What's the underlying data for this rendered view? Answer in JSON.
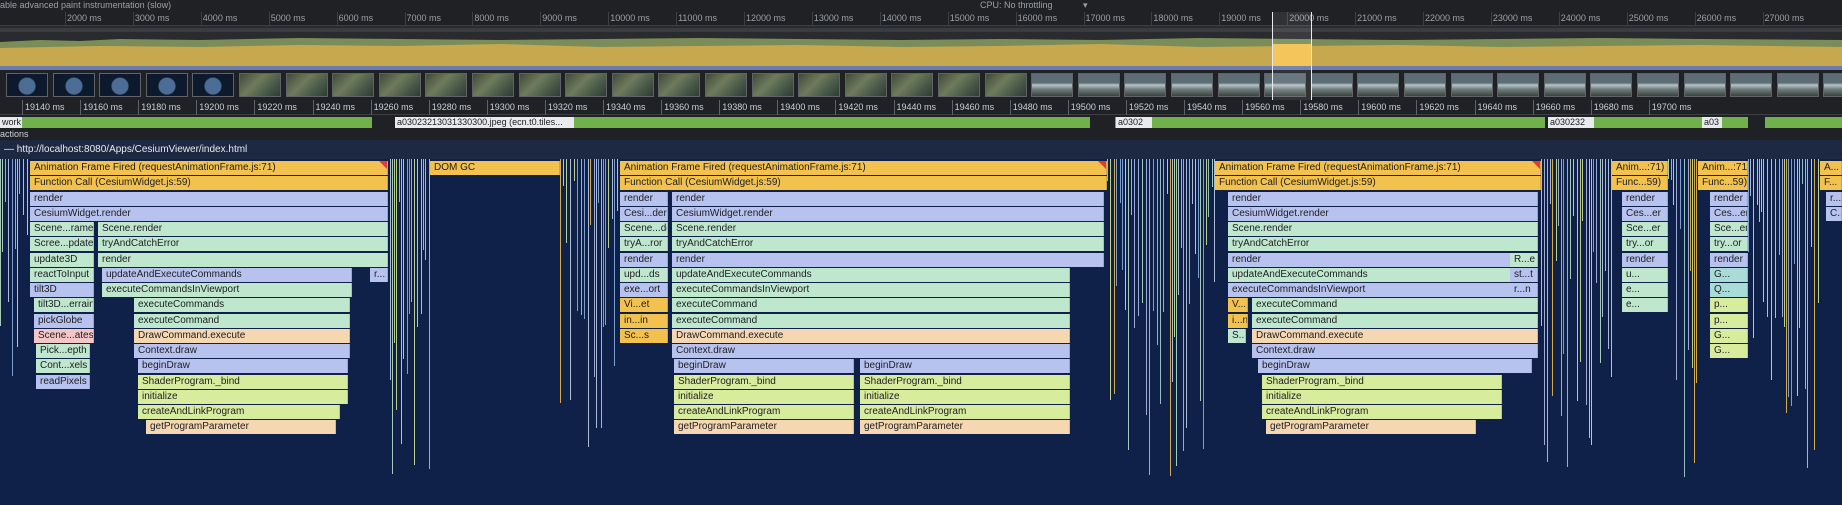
{
  "topbar": {
    "left_text": "able advanced paint instrumentation (slow)",
    "cpu_text": "CPU:  No throttling"
  },
  "overview_ticks": [
    "2000 ms",
    "3000 ms",
    "4000 ms",
    "5000 ms",
    "6000 ms",
    "7000 ms",
    "8000 ms",
    "9000 ms",
    "10000 ms",
    "11000 ms",
    "12000 ms",
    "13000 ms",
    "14000 ms",
    "15000 ms",
    "16000 ms",
    "17000 ms",
    "18000 ms",
    "19000 ms",
    "20000 ms",
    "21000 ms",
    "22000 ms",
    "23000 ms",
    "24000 ms",
    "25000 ms",
    "26000 ms",
    "27000 ms"
  ],
  "ruler_ticks": [
    "19140 ms",
    "19160 ms",
    "19180 ms",
    "19200 ms",
    "19220 ms",
    "19240 ms",
    "19260 ms",
    "19280 ms",
    "19300 ms",
    "19320 ms",
    "19340 ms",
    "19360 ms",
    "19380 ms",
    "19400 ms",
    "19420 ms",
    "19440 ms",
    "19460 ms",
    "19480 ms",
    "19500 ms",
    "19520 ms",
    "19540 ms",
    "19560 ms",
    "19580 ms",
    "19600 ms",
    "19620 ms",
    "19640 ms",
    "19660 ms",
    "19680 ms",
    "19700 ms"
  ],
  "network": {
    "track_label": "work",
    "requests": [
      "a03023213031330300.jpeg (ecn.t0.tiles...",
      "a0302",
      "a030232",
      "a03"
    ]
  },
  "interactions_label": "actions",
  "main_thread_label": "— http://localhost:8080/Apps/CesiumViewer/index.html",
  "flame": {
    "b1": {
      "animation": "Animation Frame Fired (requestAnimationFrame.js:71)",
      "function_call": "Function Call (CesiumWidget.js:59)",
      "left": [
        "render",
        "CesiumWidget.render",
        "Scene...rame",
        "Scree...pdate",
        "update3D",
        "reactToInput",
        "tilt3D",
        "tilt3D...errain",
        "pickGlobe",
        "Scene...ates",
        "Pick...epth",
        "Cont...xels",
        "readPixels"
      ],
      "right": [
        "Scene.render",
        "tryAndCatchError",
        "render",
        "updateAndExecuteCommands",
        "executeCommandsInViewport",
        "executeCommands",
        "executeCommand",
        "DrawCommand.execute",
        "Context.draw",
        "beginDraw",
        "ShaderProgram._bind",
        "initialize",
        "createAndLinkProgram",
        "getProgramParameter"
      ],
      "small": "r..."
    },
    "gc": "DOM GC",
    "b2": {
      "animation": "Animation Frame Fired (requestAnimationFrame.js:71)",
      "function_call": "Function Call (CesiumWidget.js:59)",
      "left": [
        "render",
        "Cesi...der",
        "Scene...der",
        "tryA...ror",
        "render",
        "upd...ds",
        "exe...ort",
        "Vi...et",
        "in...in",
        "Sc...s"
      ],
      "right": [
        "render",
        "CesiumWidget.render",
        "Scene.render",
        "tryAndCatchError",
        "render",
        "updateAndExecuteCommands",
        "executeCommandsInViewport",
        "executeCommand",
        "executeCommand",
        "DrawCommand.execute",
        "Context.draw"
      ],
      "deep_a": [
        "beginDraw",
        "ShaderProgram._bind",
        "initialize",
        "createAndLinkProgram",
        "getProgramParameter"
      ],
      "deep_b": [
        "beginDraw",
        "ShaderProgram._bind",
        "initialize",
        "createAndLinkProgram",
        "getProgramParameter"
      ]
    },
    "b3": {
      "animation": "Animation Frame Fired (requestAnimationFrame.js:71)",
      "function_call": "Function Call (CesiumWidget.js:59)",
      "main": [
        "render",
        "CesiumWidget.render",
        "Scene.render",
        "tryAndCatchError",
        "render",
        "updateAndExecuteCommands",
        "executeCommandsInViewport",
        "executeCommand",
        "executeCommand",
        "DrawCommand.execute",
        "Context.draw",
        "beginDraw",
        "ShaderProgram._bind",
        "initialize",
        "createAndLinkProgram",
        "getProgramParameter"
      ],
      "left": [
        "V...",
        "i...n",
        "S..."
      ],
      "right": [
        "R...e",
        "st...t",
        "r...n"
      ]
    },
    "b4": {
      "animation": "Anim...:71)",
      "function_call": "Func...59)",
      "items": [
        "render",
        "Ces...er",
        "Sce...er",
        "try...or",
        "render",
        "u...",
        "e...",
        "e..."
      ]
    },
    "b5": {
      "animation": "Anim...:71)",
      "function_call": "Func...59)",
      "items": [
        "render",
        "Ces...er",
        "Sce...er",
        "try...or",
        "render",
        "G...",
        "Q...",
        "p...",
        "p...",
        "G...",
        "G..."
      ]
    },
    "b6": {
      "animation": "A...",
      "function_call": "F...",
      "items": [
        "r...",
        "C..."
      ]
    }
  }
}
